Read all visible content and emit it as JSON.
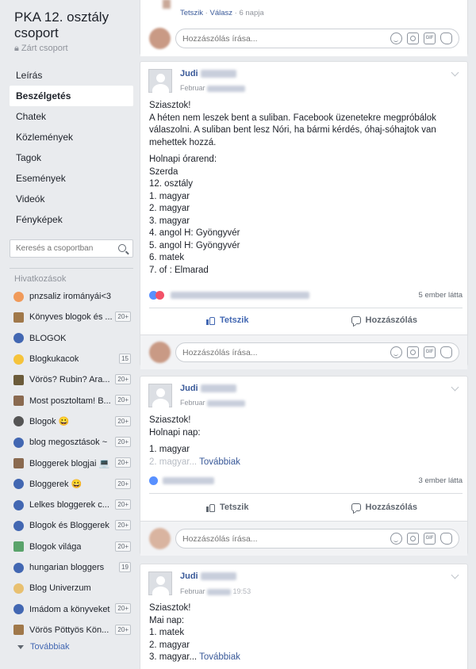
{
  "group": {
    "name": "PKA 12. osztály csoport",
    "privacy": "Zárt csoport"
  },
  "nav": [
    {
      "label": "Leírás",
      "active": false
    },
    {
      "label": "Beszélgetés",
      "active": true
    },
    {
      "label": "Chatek",
      "active": false
    },
    {
      "label": "Közlemények",
      "active": false
    },
    {
      "label": "Tagok",
      "active": false
    },
    {
      "label": "Események",
      "active": false
    },
    {
      "label": "Videók",
      "active": false
    },
    {
      "label": "Fényképek",
      "active": false
    }
  ],
  "search": {
    "placeholder": "Keresés a csoportban"
  },
  "links": {
    "header": "Hivatkozások",
    "items": [
      {
        "label": "pnzsaliz irományái<3",
        "badge": "",
        "icon": "pencil-icon",
        "color": "#f09a5a"
      },
      {
        "label": "Könyves blogok és ...",
        "badge": "20+",
        "icon": "book-icon",
        "color": "#a0784a"
      },
      {
        "label": "BLOGOK",
        "badge": "",
        "icon": "group-icon",
        "color": "#4267b2"
      },
      {
        "label": "Blogkukacok",
        "badge": "15",
        "icon": "smiley-icon",
        "color": "#f5c33b"
      },
      {
        "label": "Vörös? Rubin? Ara...",
        "badge": "20+",
        "icon": "book-cover-icon",
        "color": "#6b5b3a"
      },
      {
        "label": "Most posztoltam! B...",
        "badge": "20+",
        "icon": "cup-icon",
        "color": "#8a6a50"
      },
      {
        "label": "Blogok 😀",
        "badge": "20+",
        "icon": "skull-icon",
        "color": "#555"
      },
      {
        "label": "blog megosztások ~",
        "badge": "20+",
        "icon": "group-icon",
        "color": "#4267b2"
      },
      {
        "label": "Bloggerek blogjai 💻",
        "badge": "20+",
        "icon": "cup-icon",
        "color": "#8a6a50"
      },
      {
        "label": "Bloggerek 😀",
        "badge": "20+",
        "icon": "group-icon",
        "color": "#4267b2"
      },
      {
        "label": "Lelkes bloggerek c...",
        "badge": "20+",
        "icon": "group-icon",
        "color": "#4267b2"
      },
      {
        "label": "Blogok és Bloggerek",
        "badge": "20+",
        "icon": "group-icon",
        "color": "#4267b2"
      },
      {
        "label": "Blogok világa",
        "badge": "20+",
        "icon": "landscape-icon",
        "color": "#5aa36b"
      },
      {
        "label": "hungarian bloggers",
        "badge": "19",
        "icon": "group-icon",
        "color": "#4267b2"
      },
      {
        "label": "Blog Univerzum",
        "badge": "",
        "icon": "candle-icon",
        "color": "#e8c070"
      },
      {
        "label": "Imádom a könyveket",
        "badge": "20+",
        "icon": "group-icon",
        "color": "#4267b2"
      },
      {
        "label": "Vörös Pöttyös Kön...",
        "badge": "20+",
        "icon": "book-icon",
        "color": "#a0784a"
      }
    ],
    "more": "Továbbiak"
  },
  "prev_card": {
    "like": "Tetszik",
    "reply": "Válasz",
    "time": "6 napja",
    "comment_placeholder": "Hozzászólás írása..."
  },
  "posts": [
    {
      "author": "Judi",
      "date": "Februar",
      "greeting": "Sziasztok!",
      "intro": "A héten nem leszek bent a suliban. Facebook üzenetekre megpróbálok válaszolni. A suliban bent lesz Nóri, ha bármi kérdés, óhaj-sóhajtok van mehettek hozzá.",
      "lines": [
        "Holnapi órarend:",
        "Szerda",
        "12. osztály",
        "1. magyar",
        "2. magyar",
        "3. magyar",
        "4. angol H: Gyöngyvér",
        "5. angol H: Gyöngyvér",
        "6. matek",
        "7. of : Elmarad"
      ],
      "views": "5 ember látta",
      "like": "Tetszik",
      "comment": "Hozzászólás",
      "comment_placeholder": "Hozzászólás írása..."
    },
    {
      "author": "Judi",
      "date": "Februar",
      "greeting": "Sziasztok!",
      "lines": [
        "Holnapi nap:"
      ],
      "line1": "1. magyar",
      "line2": "2. magyar...",
      "see_more": "Továbbiak",
      "views": "3 ember látta",
      "like": "Tetszik",
      "comment": "Hozzászólás",
      "comment_placeholder": "Hozzászólás írása..."
    },
    {
      "author": "Judi",
      "date": "Februar",
      "time": "19:53",
      "greeting": "Sziasztok!",
      "lines": [
        "Mai nap:",
        "1. matek",
        "2. magyar"
      ],
      "last_line": "3. magyar...",
      "see_more": "Továbbiak"
    }
  ],
  "comment_icons": [
    "emoji-icon",
    "camera-icon",
    "gif-icon",
    "sticker-icon"
  ],
  "gif_label": "GIF"
}
